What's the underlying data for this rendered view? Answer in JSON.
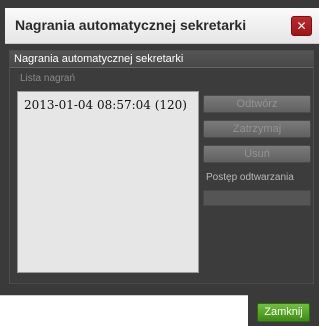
{
  "window": {
    "title": "Nagrania automatycznej sekretarki"
  },
  "panel": {
    "header": "Nagrania automatycznej sekretarki",
    "list_label": "Lista nagrań",
    "recordings": [
      {
        "label": "2013-01-04 08:57:04 (120)"
      }
    ]
  },
  "controls": {
    "play_label": "Odtwórz",
    "stop_label": "Zatrzymaj",
    "delete_label": "Usuń",
    "progress_label": "Postęp odtwarzania",
    "progress_value": 0
  },
  "footer": {
    "close_label": "Zamknij"
  },
  "colors": {
    "close_icon_red": "#b01e21",
    "confirm_green": "#4e9e1e",
    "disabled_text": "#929292"
  },
  "icons": {
    "close": "close-icon"
  }
}
